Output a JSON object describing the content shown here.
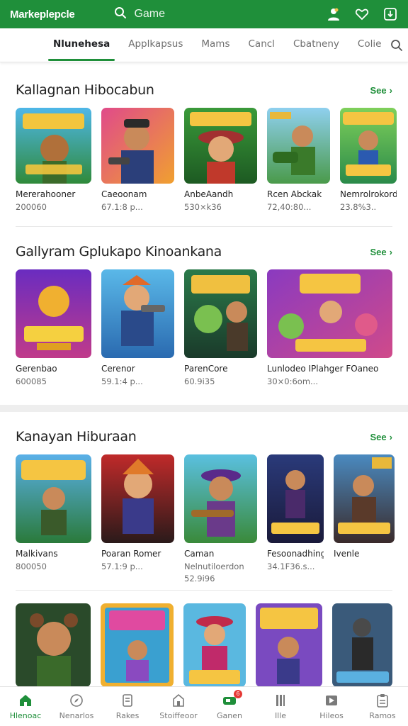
{
  "topbar": {
    "brand": "Markeplepcle",
    "search_placeholder": "Game",
    "icons": [
      "search-icon",
      "profile-icon",
      "heart-icon",
      "download-icon"
    ]
  },
  "tabs": [
    "Nlunehesa",
    "Applkapsus",
    "Mams",
    "Cancl",
    "Cbatneny",
    "Colie"
  ],
  "sections": [
    {
      "title": "Kallagnan Hibocabun",
      "see": "See",
      "items": [
        {
          "name": "Mererahooner",
          "meta": "200060"
        },
        {
          "name": "Caeoonam",
          "meta": "67.1:8 p..."
        },
        {
          "name": "AnbeAandh",
          "meta": "530×k36"
        },
        {
          "name": "Rcen Abckak",
          "meta": "72,40:80..."
        },
        {
          "name": "Nemrolrokordoo",
          "meta": "23.8%3.."
        }
      ]
    },
    {
      "title": "Gallyram Gplukapo Kinoankana",
      "see": "See",
      "items": [
        {
          "name": "Gerenbao",
          "meta": "600085"
        },
        {
          "name": "Cerenor",
          "meta": "59.1:4 p..."
        },
        {
          "name": "ParenCore",
          "meta": "60.9i35"
        },
        {
          "name": "Lunlodeo IPlahger FOaneo",
          "meta": "30×0:6om..."
        }
      ]
    },
    {
      "title": "Kanayan Hiburaan",
      "see": "See",
      "items": [
        {
          "name": "Malkivans",
          "meta": "800050",
          "meta2": ""
        },
        {
          "name": "Poaran Romer",
          "meta": "57.1:9 p...",
          "meta2": ""
        },
        {
          "name": "Caman",
          "meta": "Nelnutiloerdon",
          "meta2": "52.9i96"
        },
        {
          "name": "Fesoonadhingie",
          "meta": "34.1F36.s...",
          "meta2": ""
        },
        {
          "name": "Ivenle",
          "meta": "",
          "meta2": ""
        }
      ]
    }
  ],
  "bottom_nav": [
    {
      "label": "Hlenoac",
      "icon": "home-icon",
      "active": true
    },
    {
      "label": "Nenarlos",
      "icon": "compass-icon"
    },
    {
      "label": "Rakes",
      "icon": "list-icon"
    },
    {
      "label": "Stoiffeoor",
      "icon": "store-icon"
    },
    {
      "label": "Ganen",
      "icon": "gamepad-icon",
      "badge": "6"
    },
    {
      "label": "Ille",
      "icon": "bookmark-icon"
    },
    {
      "label": "Hileos",
      "icon": "video-icon"
    },
    {
      "label": "Ramos",
      "icon": "clipboard-icon"
    }
  ],
  "colors": {
    "accent": "#1f8f3a",
    "badge": "#e53935"
  }
}
